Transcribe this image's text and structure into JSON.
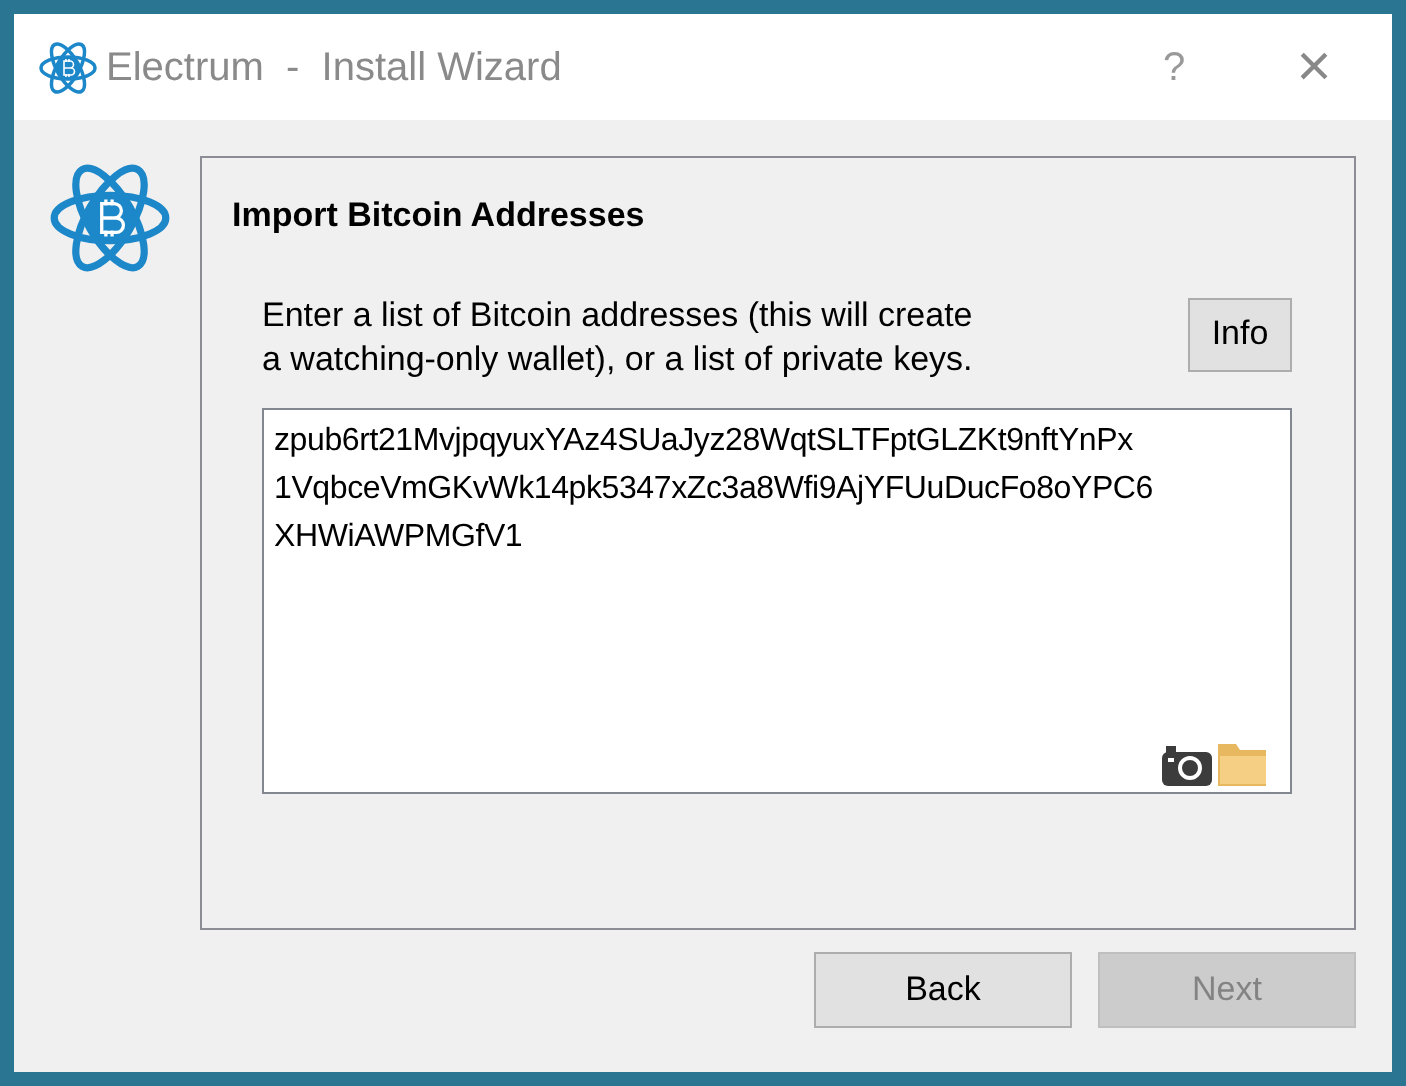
{
  "window": {
    "title": "Electrum  -  Install Wizard",
    "help": "?",
    "close": "×"
  },
  "page": {
    "heading": "Import Bitcoin Addresses",
    "description": "Enter a list of Bitcoin addresses (this will create\na watching-only wallet), or a list of private keys.",
    "info_button": "Info",
    "input": {
      "value_lines": [
        "zpub6rt21MvjpqyuxYAz4SUaJyz28WqtSLTFptGLZKt9nftYnPx",
        "1VqbceVmGKvWk14pk5347xZc3a8Wfi9AjYFUuDucFo8oYPC6",
        "XHWiAWPMGfV1"
      ]
    }
  },
  "buttons": [
    {
      "label": "Back",
      "disabled": false
    },
    {
      "label": "Next",
      "disabled": true
    }
  ]
}
